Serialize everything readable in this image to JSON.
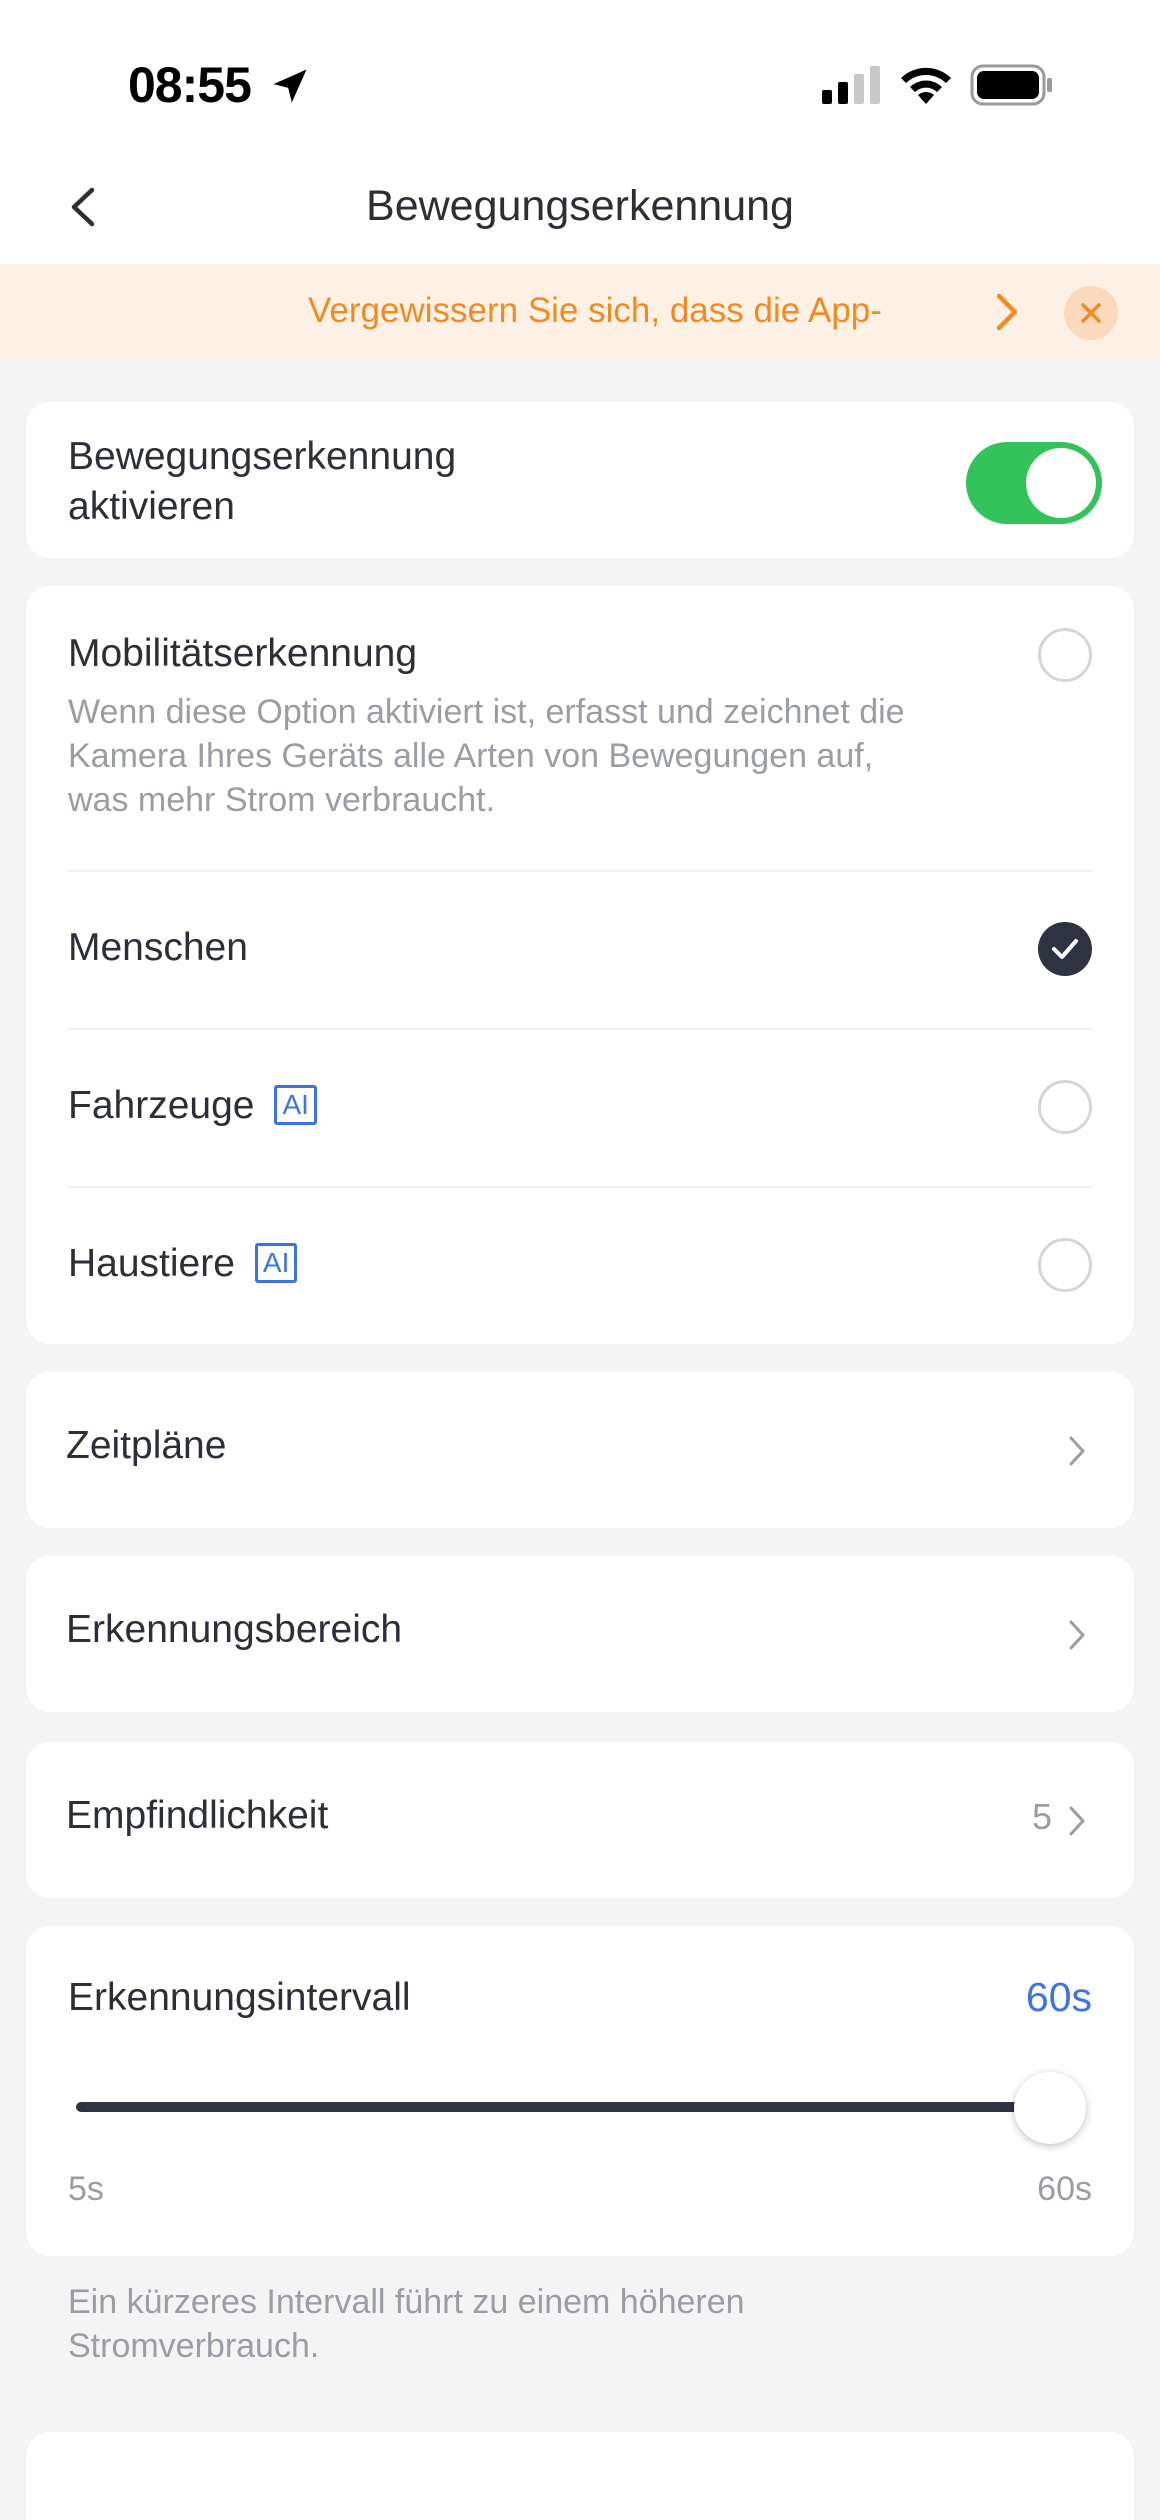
{
  "status_bar": {
    "time": "08:55",
    "icons": [
      "location-arrow-icon",
      "cellular-signal-icon",
      "wifi-icon",
      "battery-icon"
    ]
  },
  "nav": {
    "title": "Bewegungserkennung",
    "back_icon": "chevron-left-icon"
  },
  "banner": {
    "text": "Vergewissern Sie sich, dass die App-",
    "color": "#f28a22",
    "background": "#fdf1e6"
  },
  "enable_card": {
    "label": "Bewegungserkennung aktivieren",
    "enabled": true,
    "toggle_color": "#34c35a"
  },
  "detection_types": {
    "mobility": {
      "title": "Mobilitätserkennung",
      "description": "Wenn diese Option aktiviert ist, erfasst und zeichnet die Kamera Ihres Geräts alle Arten von Bewegungen auf, was mehr Strom verbraucht.",
      "selected": false
    },
    "people": {
      "title": "Menschen",
      "selected": true
    },
    "vehicles": {
      "title": "Fahrzeuge",
      "badge": "AI",
      "selected": false
    },
    "pets": {
      "title": "Haustiere",
      "badge": "AI",
      "selected": false
    }
  },
  "schedules": {
    "label": "Zeitpläne"
  },
  "detection_area": {
    "label": "Erkennungsbereich"
  },
  "sensitivity": {
    "label": "Empfindlichkeit",
    "value": "5"
  },
  "interval": {
    "label": "Erkennungsintervall",
    "value": "60s",
    "min_label": "5s",
    "max_label": "60s",
    "slider_fraction": 1.0,
    "accent_color": "#3e74e0"
  },
  "footnote": "Ein kürzeres Intervall führt zu einem höheren Stromverbrauch."
}
